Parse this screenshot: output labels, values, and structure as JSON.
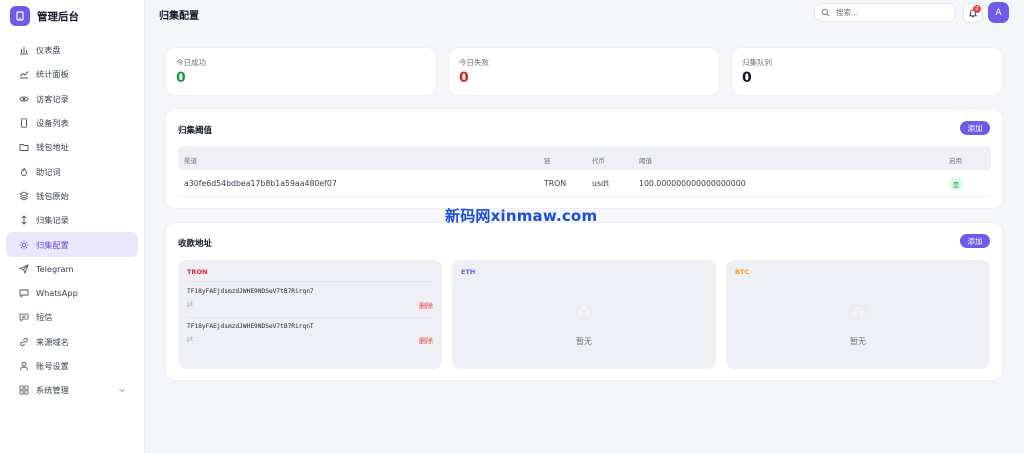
{
  "app": {
    "title": "管理后台"
  },
  "sidebar": {
    "items": [
      {
        "label": "仪表盘",
        "icon": "bar-chart-icon"
      },
      {
        "label": "统计面板",
        "icon": "trend-chart-icon"
      },
      {
        "label": "访客记录",
        "icon": "eye-icon"
      },
      {
        "label": "设备列表",
        "icon": "device-icon"
      },
      {
        "label": "钱包地址",
        "icon": "folder-icon"
      },
      {
        "label": "助记词",
        "icon": "fire-icon"
      },
      {
        "label": "钱包原始",
        "icon": "layers-icon"
      },
      {
        "label": "归集记录",
        "icon": "swap-vertical-icon"
      },
      {
        "label": "归集配置",
        "icon": "sun-icon",
        "active": true
      },
      {
        "label": "Telegram",
        "icon": "send-icon"
      },
      {
        "label": "WhatsApp",
        "icon": "chat-bubble-icon"
      },
      {
        "label": "短信",
        "icon": "message-icon"
      },
      {
        "label": "来源域名",
        "icon": "link-icon"
      },
      {
        "label": "账号设置",
        "icon": "user-icon"
      },
      {
        "label": "系统管理",
        "icon": "grid-icon"
      }
    ]
  },
  "header": {
    "title": "归集配置",
    "search_placeholder": "搜索...",
    "notification_count": "2",
    "avatar_letter": "A"
  },
  "stats": [
    {
      "label": "今日成功",
      "value": "0",
      "color": "#16a34a"
    },
    {
      "label": "今日失败",
      "value": "0",
      "color": "#dc2626"
    },
    {
      "label": "归集队列",
      "value": "0",
      "color": "#111827"
    }
  ],
  "threshold": {
    "title": "归集阈值",
    "add_label": "添加",
    "columns": [
      "渠道",
      "链",
      "代币",
      "阈值",
      "启用"
    ],
    "rows": [
      {
        "channel": "a30fe6d54bdbea17b8b1a59aa480ef07",
        "chain": "TRON",
        "token": "usdt",
        "threshold": "100.000000000000000000",
        "enabled": "是"
      }
    ]
  },
  "receive": {
    "title": "收款地址",
    "add_label": "添加",
    "chains": [
      {
        "name": "TRON",
        "color": "#dc2626",
        "addresses": [
          {
            "address": "TF18yFAEjdsmzdJWHE9NDSeV7tB7Rirqn7",
            "note": "pt",
            "delete_label": "删除"
          },
          {
            "address": "TF18yFAEjdsmzdJWHE9NDSeV7tB7RirqnT",
            "note": "pt",
            "delete_label": "删除"
          }
        ]
      },
      {
        "name": "ETH",
        "color": "#4f6bd6",
        "empty_text": "暂无"
      },
      {
        "name": "BTC",
        "color": "#f59e0b",
        "empty_text": "暂无"
      }
    ]
  },
  "watermark": "新码网xinmaw.com"
}
